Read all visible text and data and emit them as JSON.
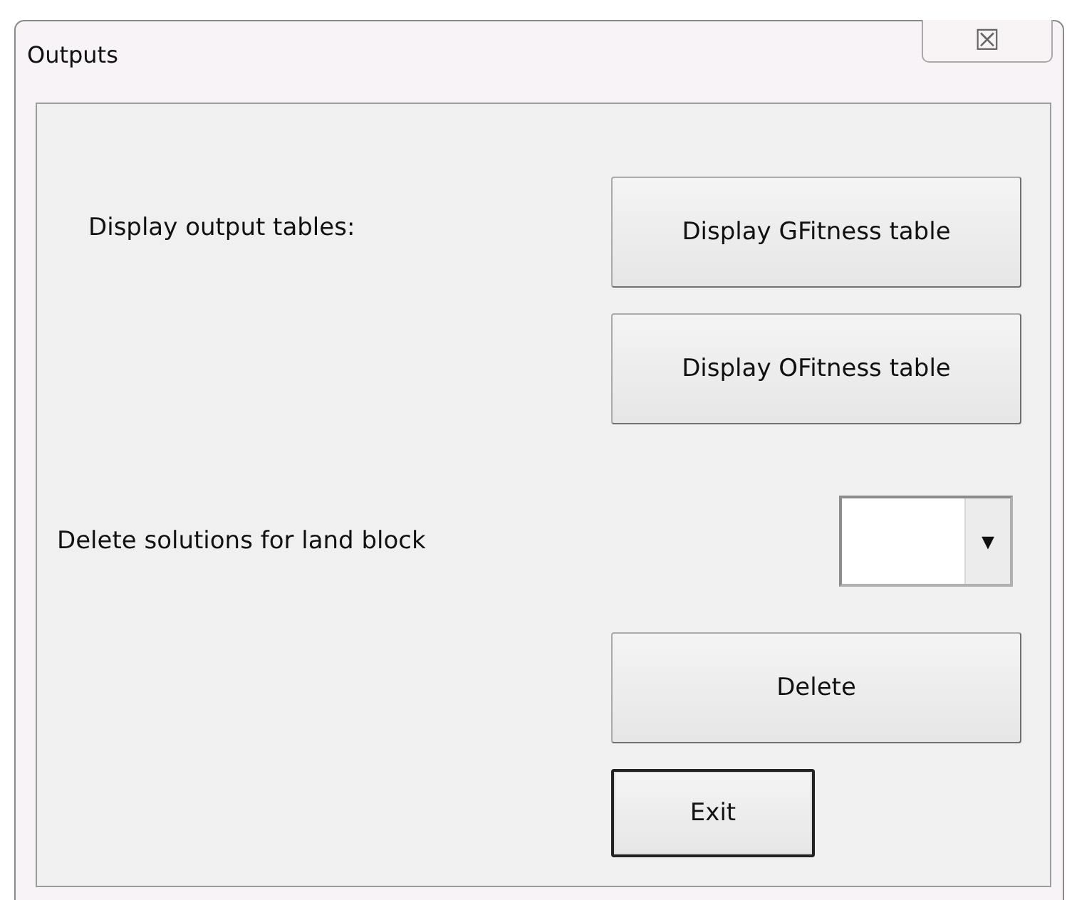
{
  "window": {
    "title": "Outputs",
    "close_glyph": "☒"
  },
  "display_label": "Display output tables:",
  "display_buttons": [
    {
      "label": "Display GFitness table",
      "default": false
    },
    {
      "label": "Display OFitness table",
      "default": false
    }
  ],
  "delete_label": "Delete solutions for land block",
  "land_block_dropdown": {
    "arrow": "▾"
  },
  "delete_button": {
    "label": "Delete",
    "default": false
  },
  "exit_button": {
    "label": "Exit",
    "default": true
  }
}
